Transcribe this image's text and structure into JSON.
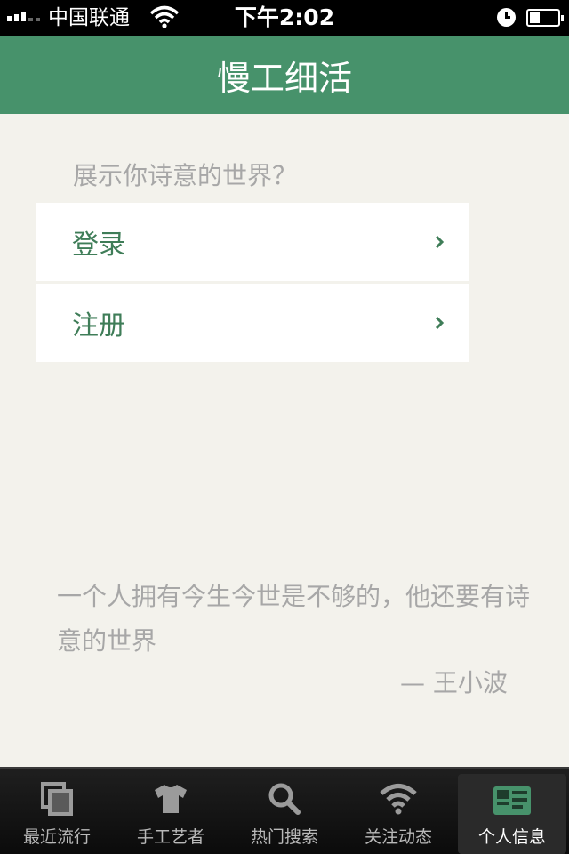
{
  "status_bar": {
    "carrier": "中国联通",
    "time": "下午2:02"
  },
  "nav": {
    "title": "慢工细活"
  },
  "prompt": "展示你诗意的世界？",
  "menu": [
    {
      "label": "登录"
    },
    {
      "label": "注册"
    }
  ],
  "quote": {
    "text": "一个人拥有今生今世是不够的，他还要有诗意的世界",
    "author": "— 王小波"
  },
  "tabs": [
    {
      "label": "最近流行",
      "icon": "layers-icon"
    },
    {
      "label": "手工艺者",
      "icon": "tshirt-icon"
    },
    {
      "label": "热门搜索",
      "icon": "search-icon"
    },
    {
      "label": "关注动态",
      "icon": "wifi-icon"
    },
    {
      "label": "个人信息",
      "icon": "id-card-icon",
      "active": true
    }
  ],
  "colors": {
    "primary": "#47926b",
    "background": "#f3f2ec",
    "text_muted": "#a7a7a7"
  }
}
